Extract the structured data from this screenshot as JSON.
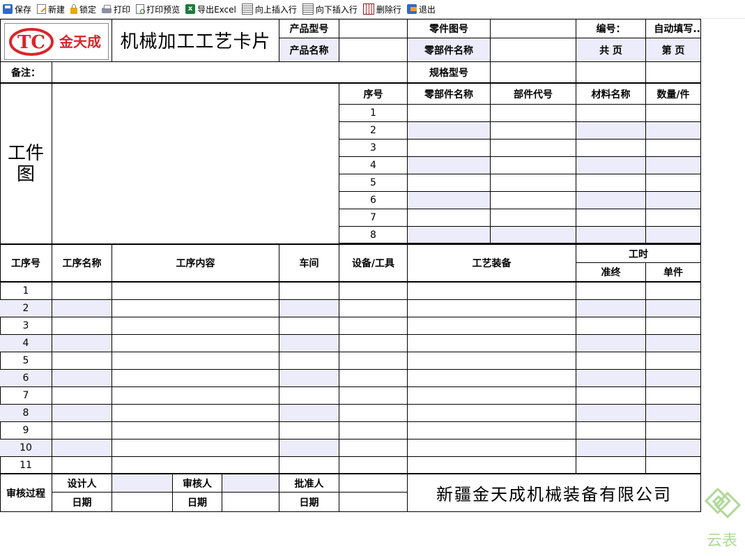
{
  "toolbar": {
    "save": "保存",
    "new": "新建",
    "lock": "锁定",
    "print": "打印",
    "print_preview": "打印预览",
    "export_excel": "导出Excel",
    "insert_above": "向上插入行",
    "insert_below": "向下插入行",
    "delete_row": "删除行",
    "exit": "退出"
  },
  "header": {
    "logo_text": "金天成",
    "logo_mark": "TC",
    "title": "机械加工工艺卡片",
    "product_model_label": "产品型号",
    "product_name_label": "产品名称",
    "part_drawing_no_label": "零件图号",
    "part_name_label": "零部件名称",
    "number_label": "编号：",
    "number_value": "自动填写..",
    "total_pages_label": "共  页",
    "page_label": "第  页",
    "remark_label": "备注：",
    "spec_model_label": "规格型号"
  },
  "drawing": {
    "label": "工件图"
  },
  "parts_table": {
    "headers": [
      "序号",
      "零部件名称",
      "部件代号",
      "材料名称",
      "数量/件"
    ],
    "rows": [
      "1",
      "2",
      "3",
      "4",
      "5",
      "6",
      "7",
      "8"
    ]
  },
  "process_table": {
    "headers": {
      "step_no": "工序号",
      "step_name": "工序名称",
      "step_content": "工序内容",
      "workshop": "车间",
      "equipment": "设备/工具",
      "tooling": "工艺装备",
      "work_hours": "工时",
      "prep_final": "准终",
      "unit": "单件"
    },
    "rows": [
      "1",
      "2",
      "3",
      "4",
      "5",
      "6",
      "7",
      "8",
      "9",
      "10",
      "11"
    ]
  },
  "footer": {
    "review_process": "审核过程",
    "designer": "设计人",
    "reviewer": "审核人",
    "approver": "批准人",
    "date1": "日期",
    "date2": "日期",
    "date3": "日期",
    "company": "新疆金天成机械装备有限公司"
  },
  "watermark_text": "云表",
  "colors": {
    "highlight": "#ececfa",
    "logo_red": "#d9262c",
    "watermark_green": "#8cc96a"
  }
}
